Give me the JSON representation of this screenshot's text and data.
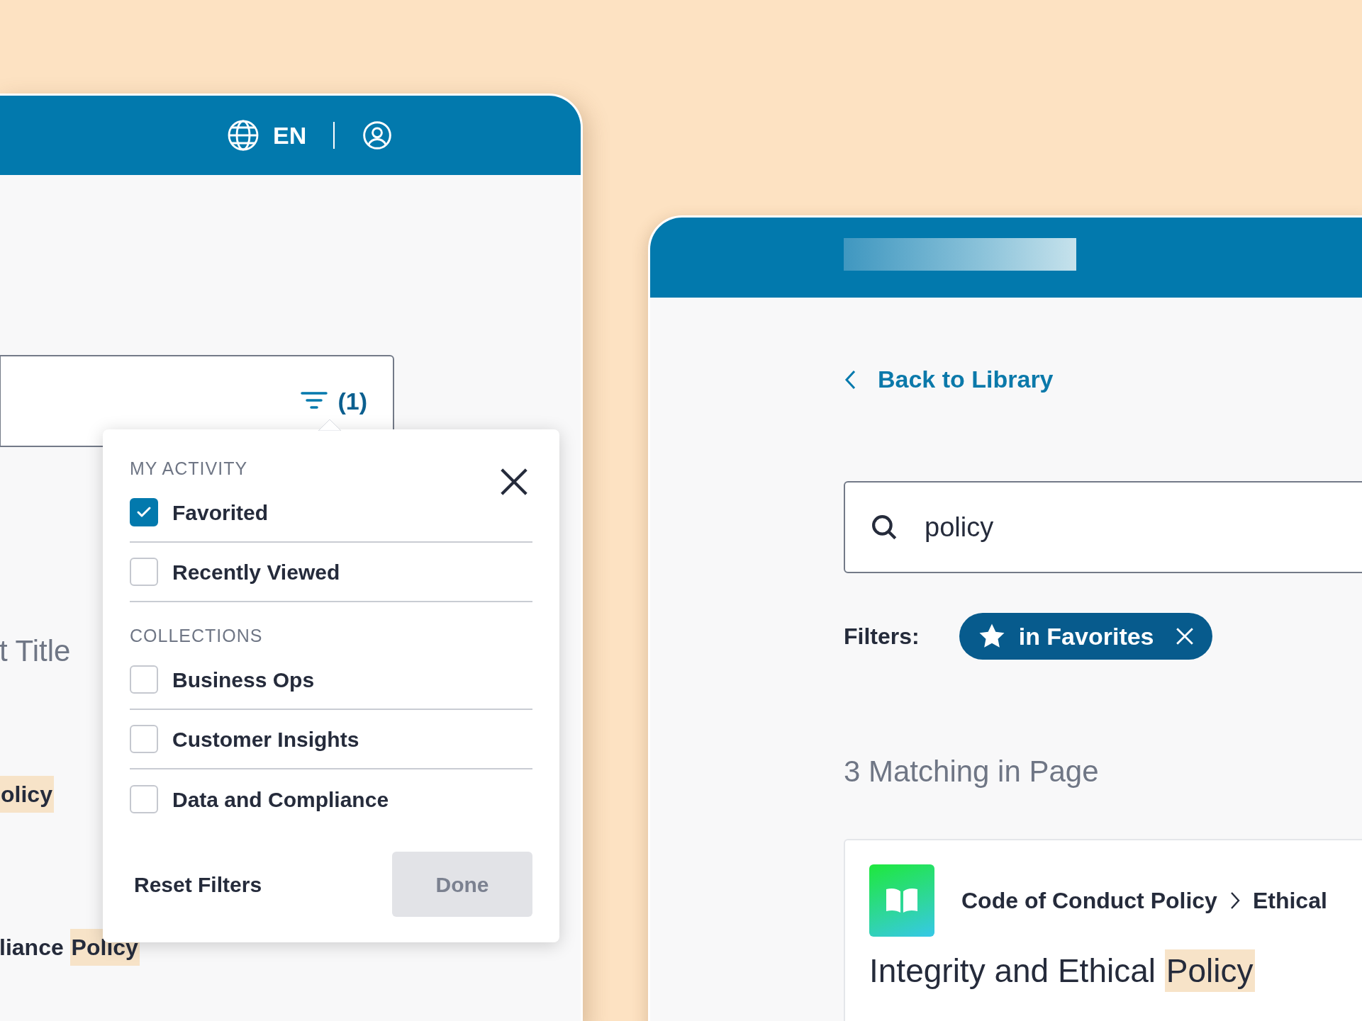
{
  "left_window": {
    "header": {
      "language": "EN"
    },
    "search": {
      "filter_count": "(1)"
    },
    "background_results": [
      {
        "kind": "title",
        "segments": [
          {
            "text": "t Title",
            "highlight": false
          }
        ]
      },
      {
        "kind": "match",
        "segments": [
          {
            "text": "olicy",
            "highlight": true
          }
        ]
      },
      {
        "kind": "match",
        "segments": [
          {
            "text": "liance ",
            "highlight": false
          },
          {
            "text": "Policy",
            "highlight": true
          }
        ]
      }
    ],
    "filter_popover": {
      "sections": [
        {
          "heading": "MY ACTIVITY",
          "options": [
            {
              "label": "Favorited",
              "checked": true
            },
            {
              "label": "Recently Viewed",
              "checked": false
            }
          ]
        },
        {
          "heading": "COLLECTIONS",
          "options": [
            {
              "label": "Business Ops",
              "checked": false
            },
            {
              "label": "Customer Insights",
              "checked": false
            },
            {
              "label": "Data and Compliance",
              "checked": false
            }
          ]
        }
      ],
      "reset_button": "Reset Filters",
      "done_button": {
        "label": "Done",
        "disabled": true
      }
    }
  },
  "right_window": {
    "back_link": "Back to Library",
    "search": {
      "value": "policy"
    },
    "filters": {
      "label": "Filters:",
      "chips": [
        {
          "label": "in Favorites"
        }
      ]
    },
    "results_heading": "3 Matching in Page",
    "result_card": {
      "breadcrumb": [
        "Code of Conduct Policy",
        "Ethical"
      ],
      "title_segments": [
        {
          "text": "Integrity and Ethical ",
          "highlight": false
        },
        {
          "text": "Policy",
          "highlight": true
        }
      ]
    }
  }
}
